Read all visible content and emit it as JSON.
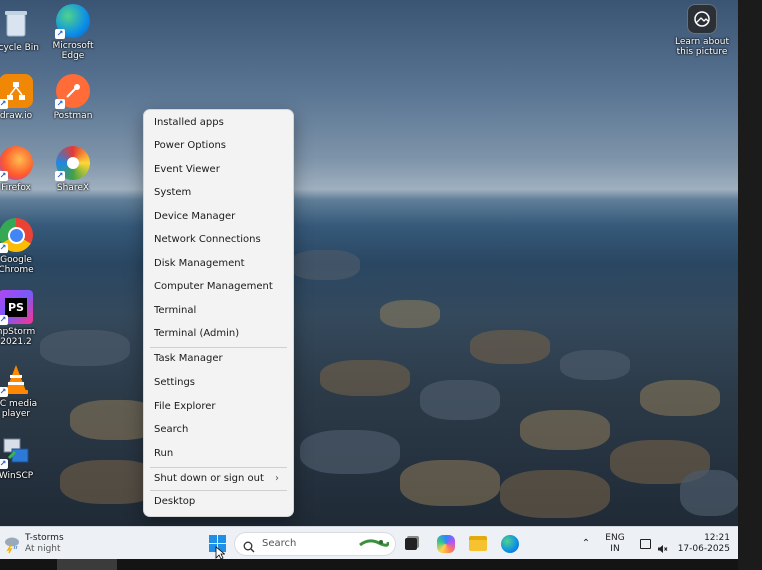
{
  "desktop": {
    "icons": [
      {
        "label": "ecycle Bin",
        "icon": "recycle-bin-icon"
      },
      {
        "label": "Microsoft\nEdge",
        "icon": "edge-icon"
      },
      {
        "label": "draw.io",
        "icon": "drawio-icon"
      },
      {
        "label": "Postman",
        "icon": "postman-icon"
      },
      {
        "label": "Firefox",
        "icon": "firefox-icon"
      },
      {
        "label": "ShareX",
        "icon": "sharex-icon"
      },
      {
        "label": "Google\nChrome",
        "icon": "chrome-icon"
      },
      {
        "label": "hpStorm\n2021.2",
        "icon": "phpstorm-icon"
      },
      {
        "label": "LC media\nplayer",
        "icon": "vlc-icon"
      },
      {
        "label": "WinSCP",
        "icon": "winscp-icon"
      }
    ],
    "learn_about": {
      "label": "Learn about\nthis picture",
      "icon": "camera-icon"
    }
  },
  "context_menu": {
    "items": [
      {
        "label": "Installed apps"
      },
      {
        "label": "Power Options"
      },
      {
        "label": "Event Viewer"
      },
      {
        "label": "System"
      },
      {
        "label": "Device Manager"
      },
      {
        "label": "Network Connections"
      },
      {
        "label": "Disk Management"
      },
      {
        "label": "Computer Management"
      },
      {
        "label": "Terminal"
      },
      {
        "label": "Terminal (Admin)"
      },
      {
        "label": "Task Manager"
      },
      {
        "label": "Settings"
      },
      {
        "label": "File Explorer"
      },
      {
        "label": "Search"
      },
      {
        "label": "Run"
      },
      {
        "label": "Shut down or sign out",
        "has_submenu": true
      },
      {
        "label": "Desktop"
      }
    ]
  },
  "taskbar": {
    "weather": {
      "title": "T-storms",
      "subtitle": "At night",
      "icon": "storm-cloud-icon"
    },
    "search_placeholder": "Search",
    "apps": [
      "start-icon",
      "task-view-icon",
      "copilot-icon",
      "file-explorer-icon",
      "edge-icon"
    ],
    "tray": {
      "language_line1": "ENG",
      "language_line2": "IN",
      "time": "12:21",
      "date": "17-06-2025"
    }
  },
  "colors": {
    "menu_bg": "#f3f3f3",
    "taskbar_bg": "#edf1f6",
    "accent_blue": "#0078d4"
  }
}
